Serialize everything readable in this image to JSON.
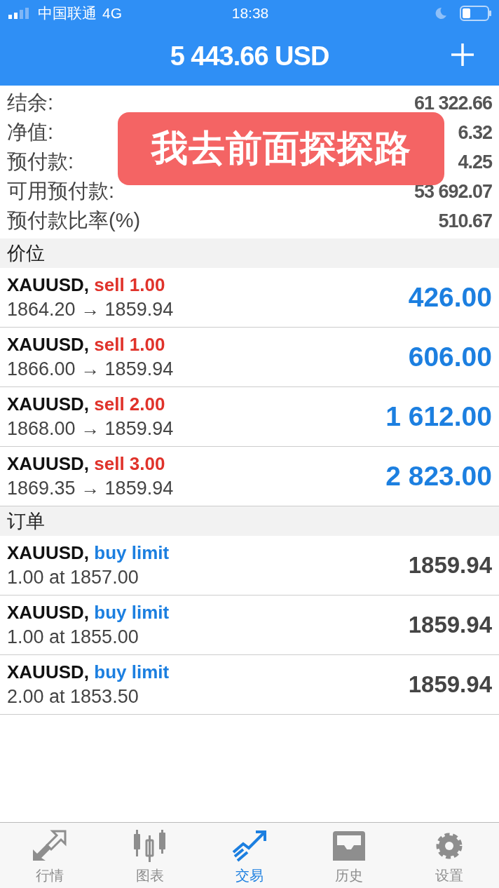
{
  "status_bar": {
    "carrier": "中国联通",
    "network": "4G",
    "time": "18:38"
  },
  "header": {
    "title": "5 443.66 USD"
  },
  "summary": [
    {
      "label": "结余:",
      "value": "61 322.66"
    },
    {
      "label": "净值:",
      "value": "6.32"
    },
    {
      "label": "预付款:",
      "value": "4.25"
    },
    {
      "label": "可用预付款:",
      "value": "53 692.07"
    },
    {
      "label": "预付款比率(%)",
      "value": "510.67"
    }
  ],
  "overlay_caption": "我去前面探探路",
  "positions": {
    "title": "价位",
    "items": [
      {
        "symbol": "XAUUSD,",
        "kind": "sell",
        "type": "sell 1.00",
        "prices": "1864.20 → 1859.94",
        "profit": "426.00"
      },
      {
        "symbol": "XAUUSD,",
        "kind": "sell",
        "type": "sell 1.00",
        "prices": "1866.00 → 1859.94",
        "profit": "606.00"
      },
      {
        "symbol": "XAUUSD,",
        "kind": "sell",
        "type": "sell 2.00",
        "prices": "1868.00 → 1859.94",
        "profit": "1 612.00"
      },
      {
        "symbol": "XAUUSD,",
        "kind": "sell",
        "type": "sell 3.00",
        "prices": "1869.35 → 1859.94",
        "profit": "2 823.00"
      }
    ]
  },
  "orders": {
    "title": "订单",
    "items": [
      {
        "symbol": "XAUUSD,",
        "kind": "buy",
        "type": "buy limit",
        "detail": "1.00 at 1857.00",
        "price": "1859.94"
      },
      {
        "symbol": "XAUUSD,",
        "kind": "buy",
        "type": "buy limit",
        "detail": "1.00 at 1855.00",
        "price": "1859.94"
      },
      {
        "symbol": "XAUUSD,",
        "kind": "buy",
        "type": "buy limit",
        "detail": "2.00 at 1853.50",
        "price": "1859.94"
      }
    ]
  },
  "tabs": [
    {
      "label": "行情",
      "selected": false
    },
    {
      "label": "图表",
      "selected": false
    },
    {
      "label": "交易",
      "selected": true
    },
    {
      "label": "历史",
      "selected": false
    },
    {
      "label": "设置",
      "selected": false
    }
  ]
}
